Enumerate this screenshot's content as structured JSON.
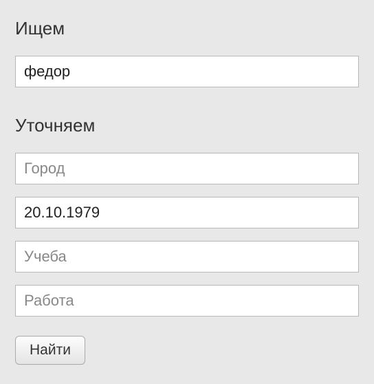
{
  "search": {
    "label": "Ищем",
    "name_value": "федор"
  },
  "refine": {
    "label": "Уточняем",
    "city_placeholder": "Город",
    "date_value": "20.10.1979",
    "education_placeholder": "Учеба",
    "work_placeholder": "Работа"
  },
  "submit": {
    "label": "Найти"
  }
}
